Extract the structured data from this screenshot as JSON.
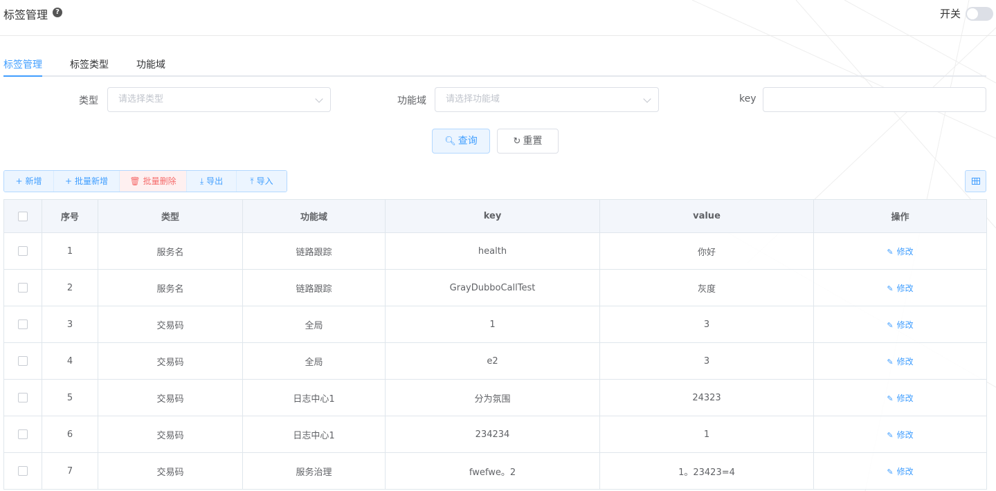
{
  "header": {
    "title": "标签管理",
    "help_icon": "question-circle-icon",
    "switch_label": "开关",
    "switch_on": false
  },
  "tabs": [
    {
      "label": "标签管理",
      "active": true
    },
    {
      "label": "标签类型",
      "active": false
    },
    {
      "label": "功能域",
      "active": false
    }
  ],
  "filters": {
    "type_label": "类型",
    "type_placeholder": "请选择类型",
    "domain_label": "功能域",
    "domain_placeholder": "请选择功能域",
    "key_label": "key",
    "key_value": ""
  },
  "actions": {
    "query_label": "查询",
    "reset_label": "重置"
  },
  "toolbar": {
    "add": "新增",
    "batch_add": "批量新增",
    "batch_delete": "批量删除",
    "export": "导出",
    "import": "导入"
  },
  "table": {
    "columns": [
      "序号",
      "类型",
      "功能域",
      "key",
      "value",
      "操作"
    ],
    "edit_label": "修改",
    "rows": [
      {
        "no": "1",
        "type": "服务名",
        "domain": "链路跟踪",
        "key": "health",
        "value": "你好"
      },
      {
        "no": "2",
        "type": "服务名",
        "domain": "链路跟踪",
        "key": "GrayDubboCallTest",
        "value": "灰度"
      },
      {
        "no": "3",
        "type": "交易码",
        "domain": "全局",
        "key": "1",
        "value": "3"
      },
      {
        "no": "4",
        "type": "交易码",
        "domain": "全局",
        "key": "e2",
        "value": "3"
      },
      {
        "no": "5",
        "type": "交易码",
        "domain": "日志中心1",
        "key": "分为氛围",
        "value": "24323"
      },
      {
        "no": "6",
        "type": "交易码",
        "domain": "日志中心1",
        "key": "234234",
        "value": "1"
      },
      {
        "no": "7",
        "type": "交易码",
        "domain": "服务治理",
        "key": "fwefwe。2",
        "value": "1。23423=4"
      }
    ]
  },
  "colors": {
    "primary": "#409eff",
    "danger": "#f56c6c",
    "header_bg": "#f3f6fb"
  }
}
